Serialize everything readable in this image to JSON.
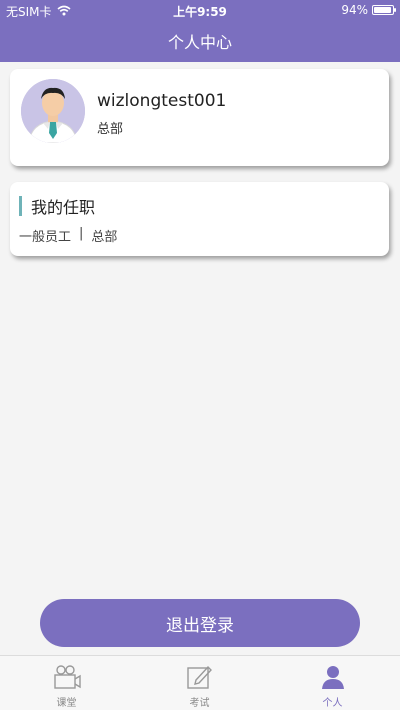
{
  "status_bar": {
    "carrier": "无SIM卡",
    "time": "上午9:59",
    "battery_text": "94%",
    "battery_level": 0.94
  },
  "nav": {
    "title": "个人中心"
  },
  "profile": {
    "username": "wizlongtest001",
    "department": "总部",
    "avatar_icon": "person-avatar-icon"
  },
  "job": {
    "title": "我的任职",
    "position": "一般员工",
    "separator": "|",
    "department": "总部"
  },
  "logout_label": "退出登录",
  "tabs": [
    {
      "label": "课堂",
      "icon": "classroom-icon",
      "active": false
    },
    {
      "label": "考试",
      "icon": "exam-edit-icon",
      "active": false
    },
    {
      "label": "个人",
      "icon": "person-icon",
      "active": true
    }
  ],
  "colors": {
    "primary": "#7b6fbf",
    "accent": "#6fb3b8",
    "background": "#f4f4f4",
    "tab_inactive": "#888888"
  }
}
